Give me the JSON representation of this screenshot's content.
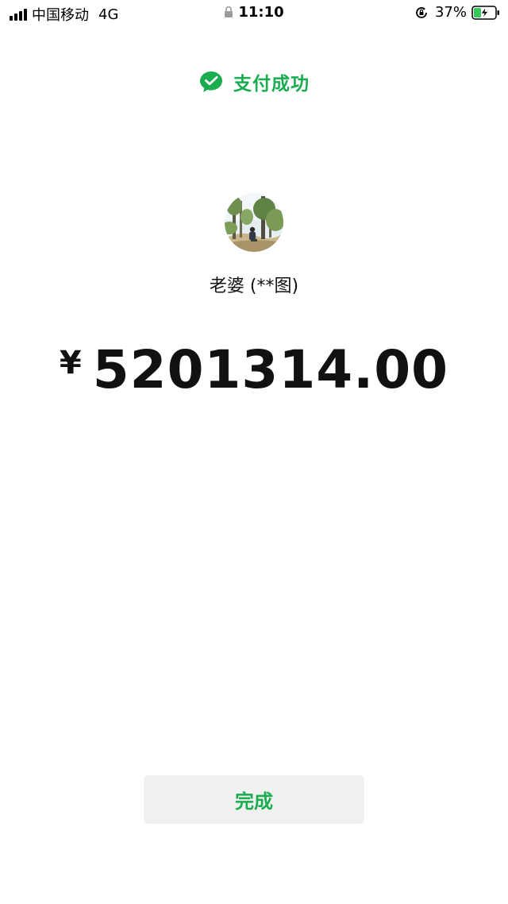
{
  "status_bar": {
    "carrier": "中国移动",
    "network": "4G",
    "time": "11:10",
    "battery": "37%"
  },
  "header": {
    "success_text": "支付成功",
    "icon": "wechat-pay-check-icon",
    "accent": "#1aad4f"
  },
  "payee": {
    "name": "老婆 (**图)"
  },
  "payment": {
    "currency": "¥",
    "amount": "5201314.00"
  },
  "actions": {
    "done_label": "完成"
  }
}
